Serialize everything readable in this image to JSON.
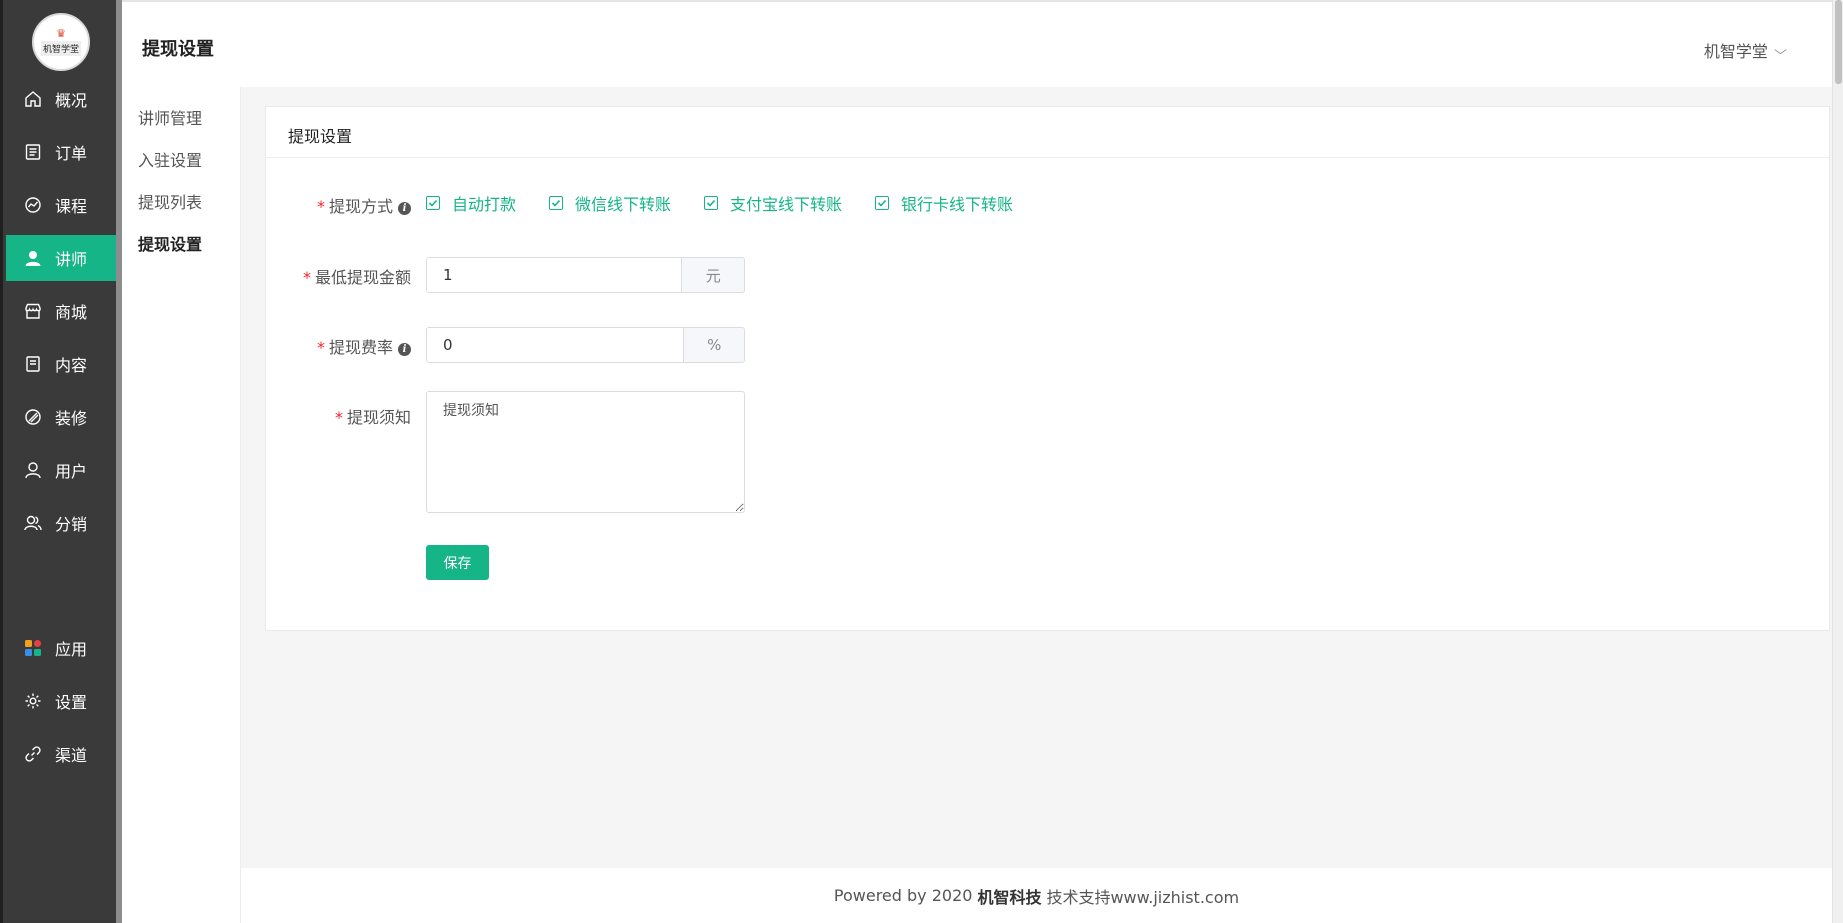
{
  "logo": {
    "text": "机智学堂"
  },
  "sidebar": {
    "items": [
      {
        "label": "概况",
        "icon": "home-icon"
      },
      {
        "label": "订单",
        "icon": "order-icon"
      },
      {
        "label": "课程",
        "icon": "course-icon"
      },
      {
        "label": "讲师",
        "icon": "teacher-icon",
        "active": true
      },
      {
        "label": "商城",
        "icon": "store-icon"
      },
      {
        "label": "内容",
        "icon": "content-icon"
      },
      {
        "label": "装修",
        "icon": "decorate-icon"
      },
      {
        "label": "用户",
        "icon": "user-icon"
      },
      {
        "label": "分销",
        "icon": "distribution-icon"
      },
      {
        "label": "应用",
        "icon": "apps-icon"
      },
      {
        "label": "设置",
        "icon": "gear-icon"
      },
      {
        "label": "渠道",
        "icon": "channel-icon"
      }
    ]
  },
  "header": {
    "title": "提现设置",
    "user": "机智学堂"
  },
  "submenu": {
    "items": [
      {
        "label": "讲师管理"
      },
      {
        "label": "入驻设置"
      },
      {
        "label": "提现列表"
      },
      {
        "label": "提现设置",
        "active": true
      }
    ]
  },
  "card": {
    "title": "提现设置",
    "form": {
      "method_label": "提现方式",
      "methods": [
        "自动打款",
        "微信线下转账",
        "支付宝线下转账",
        "银行卡线下转账"
      ],
      "min_amount_label": "最低提现金额",
      "min_amount_value": "1",
      "min_amount_unit": "元",
      "fee_rate_label": "提现费率",
      "fee_rate_value": "0",
      "fee_rate_unit": "%",
      "notice_label": "提现须知",
      "notice_value": "提现须知",
      "save_label": "保存"
    }
  },
  "footer": {
    "prefix": "Powered by 2020",
    "company": "机智科技",
    "suffix": "技术支持www.jizhist.com"
  },
  "colors": {
    "accent": "#16b587",
    "sidebar_bg": "#3a3a3a",
    "required": "#f5222d"
  }
}
